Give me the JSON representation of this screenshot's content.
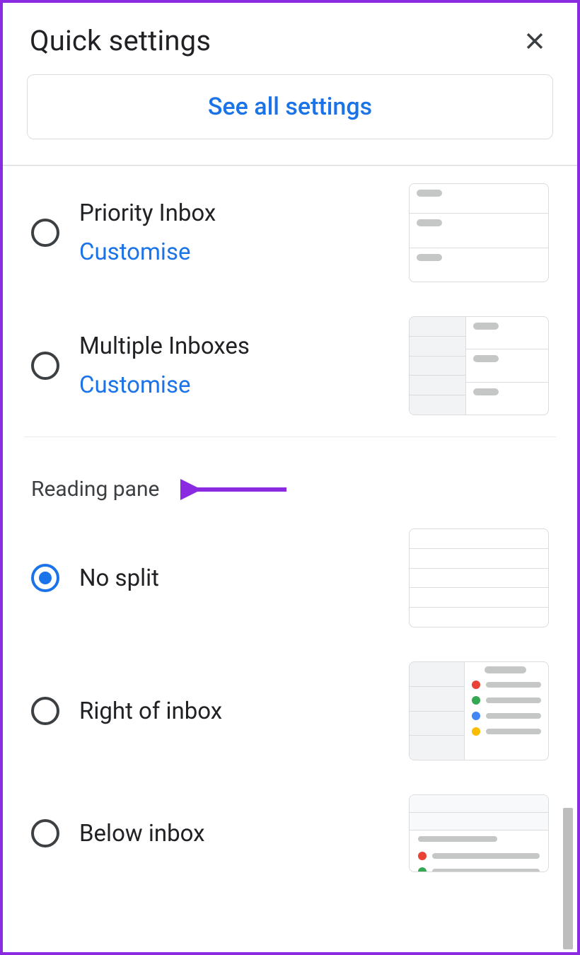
{
  "header": {
    "title": "Quick settings"
  },
  "buttons": {
    "see_all_settings": "See all settings"
  },
  "inbox_options": [
    {
      "label": "Priority Inbox",
      "link": "Customise",
      "selected": false
    },
    {
      "label": "Multiple Inboxes",
      "link": "Customise",
      "selected": false
    }
  ],
  "reading_pane": {
    "title": "Reading pane",
    "options": [
      {
        "label": "No split",
        "selected": true
      },
      {
        "label": "Right of inbox",
        "selected": false
      },
      {
        "label": "Below inbox",
        "selected": false
      }
    ]
  },
  "annotation": {
    "arrow_color": "#8a2be2"
  }
}
